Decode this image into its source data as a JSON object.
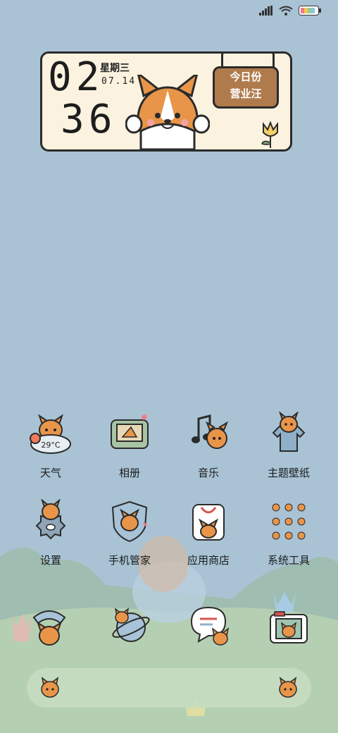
{
  "status_bar": {
    "signal_icon": "signal-icon",
    "wifi_icon": "wifi-icon",
    "battery_icon": "battery-icon"
  },
  "widget": {
    "hour": "02",
    "minute": "36",
    "weekday": "星期三",
    "date": "07.14",
    "tag_line1": "今日份",
    "tag_line2": "营业汪"
  },
  "apps_row1": [
    {
      "label": "天气",
      "icon": "weather-corgi-icon",
      "temp": "29°C"
    },
    {
      "label": "相册",
      "icon": "album-tv-icon"
    },
    {
      "label": "音乐",
      "icon": "music-note-icon"
    },
    {
      "label": "主题壁纸",
      "icon": "theme-shirt-icon"
    }
  ],
  "apps_row2": [
    {
      "label": "设置",
      "icon": "settings-gear-icon"
    },
    {
      "label": "手机管家",
      "icon": "security-shield-icon"
    },
    {
      "label": "应用商店",
      "icon": "app-store-bag-icon"
    },
    {
      "label": "系统工具",
      "icon": "system-tools-folder-icon"
    }
  ],
  "dock": [
    {
      "icon": "phone-icon"
    },
    {
      "icon": "browser-planet-icon"
    },
    {
      "icon": "messages-bubble-icon"
    },
    {
      "icon": "camera-icon"
    }
  ],
  "colors": {
    "background": "#a9c3d5",
    "widget_bg": "#fbf3df",
    "tag": "#b07b4c",
    "corgi": "#e8954a"
  }
}
